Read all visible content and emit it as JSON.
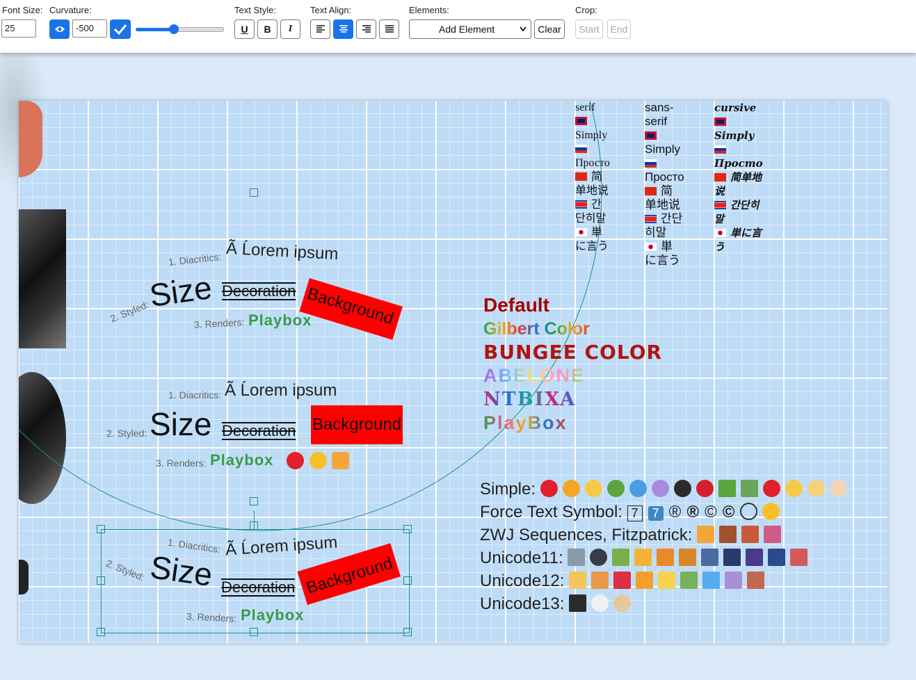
{
  "toolbar": {
    "font_size_label": "Font Size:",
    "font_size_value": "25",
    "curvature_label": "Curvature:",
    "curvature_value": "-500",
    "text_style_label": "Text Style:",
    "text_align_label": "Text Align:",
    "elements_label": "Elements:",
    "elements_selected": "Add Element",
    "clear_label": "Clear",
    "crop_label": "Crop:",
    "crop_start_label": "Start",
    "crop_end_label": "End",
    "slider_level": 0.5
  },
  "fonts_table": {
    "headers": [
      "serif",
      "sans-serif",
      "cursive"
    ],
    "rows": [
      "Simply",
      "Просто",
      "简单地说",
      "간단히말",
      "単に言う"
    ]
  },
  "text_blocks": [
    {
      "diacritics_label": "1. Diacritics:",
      "diacritics_text": "Ã Ĺorem ipsum",
      "styled_label": "2. Styled:",
      "size_text": "Size",
      "decoration_text": "Decoration",
      "background_text": "Background",
      "renders_label": "3. Renders:",
      "renders_text": "Playbox"
    },
    {
      "diacritics_label": "1. Diacritics:",
      "diacritics_text": "Ã Ĺorem ipsum",
      "styled_label": "2. Styled:",
      "size_text": "Size",
      "decoration_text": "Decoration",
      "background_text": "Background",
      "renders_label": "3. Renders:",
      "renders_text": "Playbox"
    },
    {
      "diacritics_label": "1. Diacritics:",
      "diacritics_text": "Ã Ĺorem ipsum",
      "styled_label": "2. Styled:",
      "size_text": "Size",
      "decoration_text": "Decoration",
      "background_text": "Background",
      "renders_label": "3. Renders:",
      "renders_text": "Playbox"
    }
  ],
  "color_fonts": [
    "Default",
    "Gilbert Color",
    "BUNGEE COLOR",
    "ABELONE",
    "NTBIXA",
    "PlayBox"
  ],
  "emoji_rows": {
    "simple_label": "Simple:",
    "force_label": "Force Text Symbol:",
    "zwj_label": "ZWJ Sequences, Fitzpatrick:",
    "u11_label": "Unicode11:",
    "u12_label": "Unicode12:",
    "u13_label": "Unicode13:",
    "force_symbols": [
      "7",
      "7",
      "®",
      "®",
      "©",
      "©"
    ]
  },
  "colors": {
    "accent": "#1a73e8",
    "handle": "#1a8d8d",
    "background_fill": "#ff0000",
    "default_font": "#a00000"
  }
}
